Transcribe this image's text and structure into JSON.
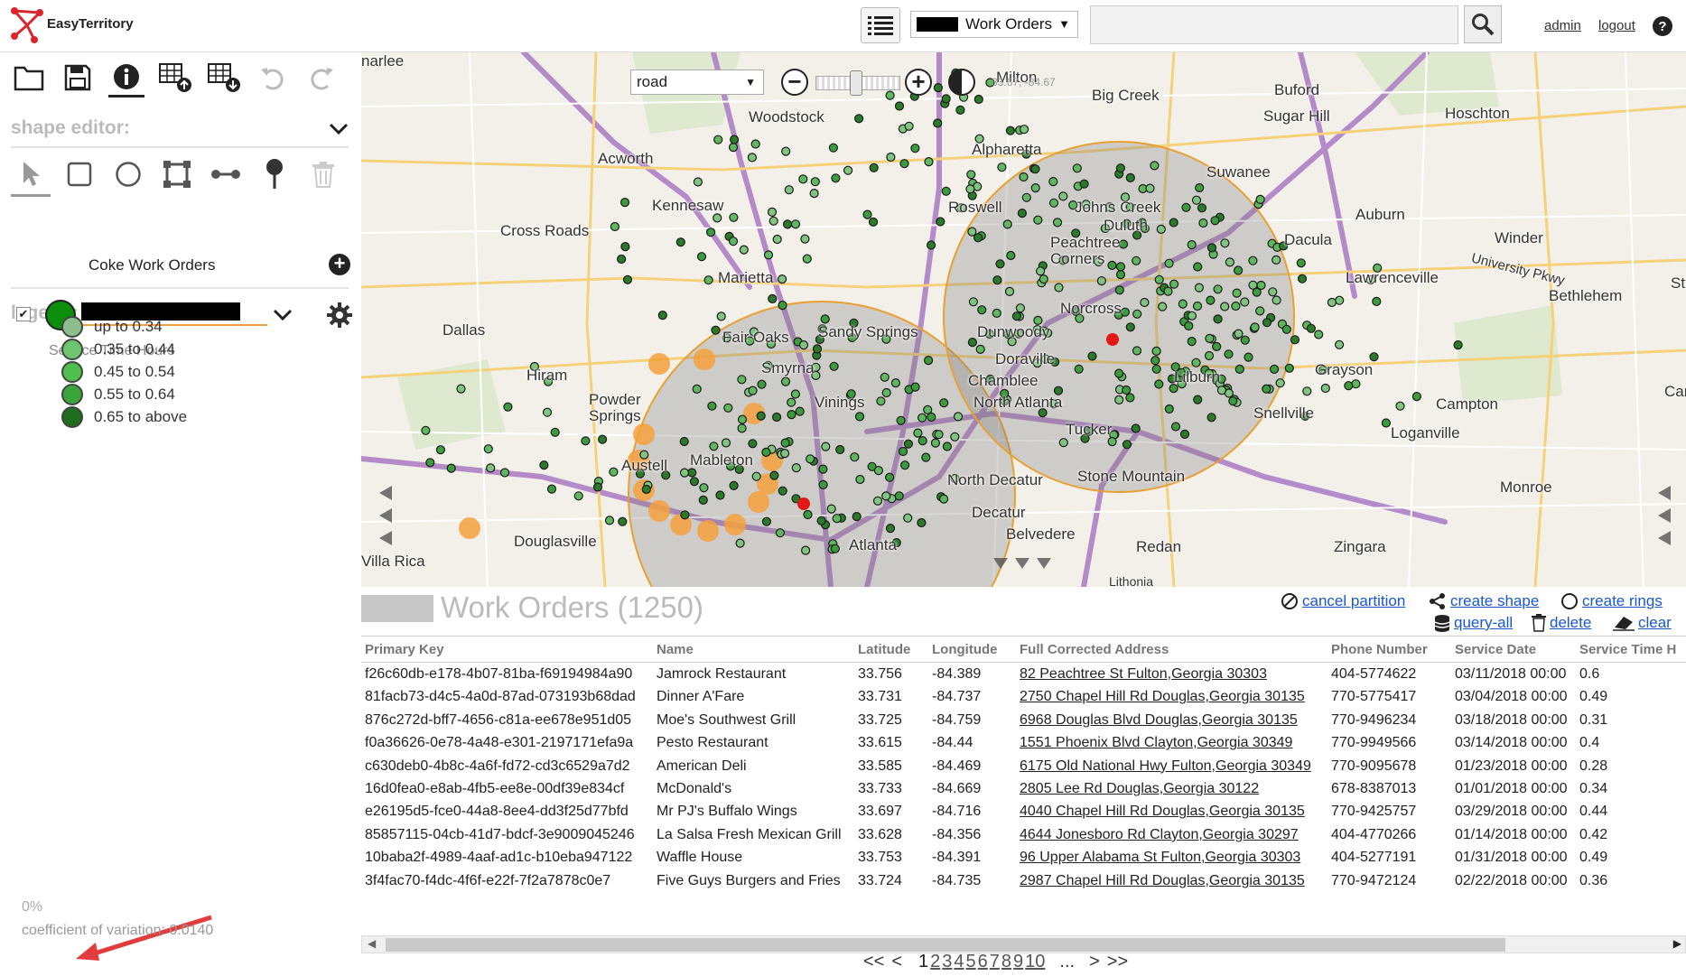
{
  "app": {
    "logo_text": "EasyTerritory"
  },
  "topbar": {
    "layer_name": "Work Orders",
    "search_placeholder": "",
    "admin_link": "admin",
    "logout_link": "logout",
    "help": "?"
  },
  "shape_editor": {
    "title": "shape editor:"
  },
  "legend": {
    "title": "legend:",
    "name": "Coke Work Orders",
    "class_title": "Service Time Hours",
    "classes": [
      {
        "label": "up to 0.34",
        "color": "#8cbf8c"
      },
      {
        "label": "0.35 to 0.44",
        "color": "#6fc46f"
      },
      {
        "label": "0.45 to 0.54",
        "color": "#4fbf4f"
      },
      {
        "label": "0.55 to 0.64",
        "color": "#3aa53a"
      },
      {
        "label": "0.65 to above",
        "color": "#1f6e1f"
      }
    ],
    "layer_color": "#0c8d0c"
  },
  "stats": {
    "percent": "0%",
    "coefficient": "coefficient of variation: 0.0140"
  },
  "map": {
    "type": "road",
    "scale_text": "33.67, -84.67",
    "labels": {
      "marlee": "narlee",
      "woodstock": "Woodstock",
      "milton": "Milton",
      "big_creek": "Big Creek",
      "buford": "Buford",
      "hoschton": "Hoschton",
      "sugar_hill": "Sugar Hill",
      "acworth": "Acworth",
      "alpharetta": "Alpharetta",
      "suwanee": "Suwanee",
      "kennesaw": "Kennesaw",
      "roswell": "Roswell",
      "johns_creek": "Johns Creek",
      "duluth": "Duluth",
      "auburn": "Auburn",
      "cross_roads": "Cross Roads",
      "dacula": "Dacula",
      "winder": "Winder",
      "peachtree_corners": "Peachtree Corners",
      "marietta": "Marietta",
      "lawrenceville": "Lawrenceville",
      "university_pkwy": "University Pkwy",
      "bethlehem": "Bethlehem",
      "dallas": "Dallas",
      "fair_oaks": "Fair Oaks",
      "sandy_springs": "Sandy Springs",
      "dunwoody": "Dunwoody",
      "norcross": "Norcross",
      "smyrna": "Smyrna",
      "doraville": "Doraville",
      "lilburn": "Lilburn",
      "grayson": "Grayson",
      "hiram": "Hiram",
      "vinings": "Vinings",
      "chamblee": "Chamblee",
      "north_atlanta": "North Atlanta",
      "campton": "Campton",
      "powder_springs": "Powder Springs",
      "snellville": "Snellville",
      "tucker": "Tucker",
      "loganville": "Loganville",
      "austell": "Austell",
      "mableton": "Mableton",
      "north_decatur": "North Decatur",
      "stone_mountain": "Stone Mountain",
      "monroe": "Monroe",
      "decatur": "Decatur",
      "belvedere": "Belvedere",
      "douglasville": "Douglasville",
      "atlanta": "Atlanta",
      "redan": "Redan",
      "zingara": "Zingara",
      "villa_rica": "Villa Rica",
      "lithonia": "Lithonia",
      "st": "St",
      "carn": "Carn"
    }
  },
  "table": {
    "title": "Work Orders (1250)",
    "actions": {
      "cancel_partition": "cancel partition",
      "create_shape": "create shape",
      "create_rings": "create rings",
      "query_all": "query-all",
      "delete": "delete",
      "clear": "clear"
    },
    "columns": [
      "Primary Key",
      "Name",
      "Latitude",
      "Longitude",
      "Full Corrected Address",
      "Phone Number",
      "Service Date",
      "Service Time H"
    ],
    "rows": [
      [
        "f26c60db-e178-4b07-81ba-f69194984a90",
        "Jamrock Restaurant",
        "33.756",
        "-84.389",
        "82 Peachtree St Fulton,Georgia 30303",
        "404-5774622",
        "03/11/2018 00:00",
        "0.6"
      ],
      [
        "81facb73-d4c5-4a0d-87ad-073193b68dad",
        "Dinner A'Fare",
        "33.731",
        "-84.737",
        "2750 Chapel Hill Rd Douglas,Georgia 30135",
        "770-5775417",
        "03/04/2018 00:00",
        "0.49"
      ],
      [
        "876c272d-bff7-4656-c81a-ee678e951d05",
        "Moe's Southwest Grill",
        "33.725",
        "-84.759",
        "6968 Douglas Blvd Douglas,Georgia 30135",
        "770-9496234",
        "03/18/2018 00:00",
        "0.31"
      ],
      [
        "f0a36626-0e78-4a48-e301-2197171efa9a",
        "Pesto Restaurant",
        "33.615",
        "-84.44",
        "1551 Phoenix Blvd Clayton,Georgia 30349",
        "770-9949566",
        "03/14/2018 00:00",
        "0.4"
      ],
      [
        "c630deb0-4b8c-4a6f-fd72-cd3c6529a7d2",
        "American Deli",
        "33.585",
        "-84.469",
        "6175 Old National Hwy Fulton,Georgia 30349",
        "770-9095678",
        "01/23/2018 00:00",
        "0.28"
      ],
      [
        "16d0fea0-e8ab-4fb5-ee8e-00df39e834cf",
        "McDonald's",
        "33.733",
        "-84.669",
        "2805 Lee Rd Douglas,Georgia 30122",
        "678-8387013",
        "01/01/2018 00:00",
        "0.34"
      ],
      [
        "e26195d5-fce0-44a8-8ee4-dd3f25d77bfd",
        "Mr PJ's Buffalo Wings",
        "33.697",
        "-84.716",
        "4040 Chapel Hill Rd Douglas,Georgia 30135",
        "770-9425757",
        "03/29/2018 00:00",
        "0.44"
      ],
      [
        "85857115-04cb-41d7-bdcf-3e9009045246",
        "La Salsa Fresh Mexican Grill",
        "33.628",
        "-84.356",
        "4644 Jonesboro Rd Clayton,Georgia 30297",
        "404-4770266",
        "01/14/2018 00:00",
        "0.42"
      ],
      [
        "10baba2f-4989-4aaf-ad1c-b10eba947122",
        "Waffle House",
        "33.753",
        "-84.391",
        "96 Upper Alabama St Fulton,Georgia 30303",
        "404-5277191",
        "01/31/2018 00:00",
        "0.49"
      ],
      [
        "3f4fac70-f4dc-4f6f-e22f-7f2a7878c0e7",
        "Five Guys Burgers and Fries",
        "33.724",
        "-84.735",
        "2987 Chapel Hill Rd Douglas,Georgia 30135",
        "770-9472124",
        "02/22/2018 00:00",
        "0.36"
      ]
    ]
  },
  "pager": {
    "first": "<<",
    "prev": "<",
    "pages": [
      "1",
      "2",
      "3",
      "4",
      "5",
      "6",
      "7",
      "8",
      "9",
      "10"
    ],
    "ellipsis": "...",
    "next": ">",
    "last": ">>"
  }
}
